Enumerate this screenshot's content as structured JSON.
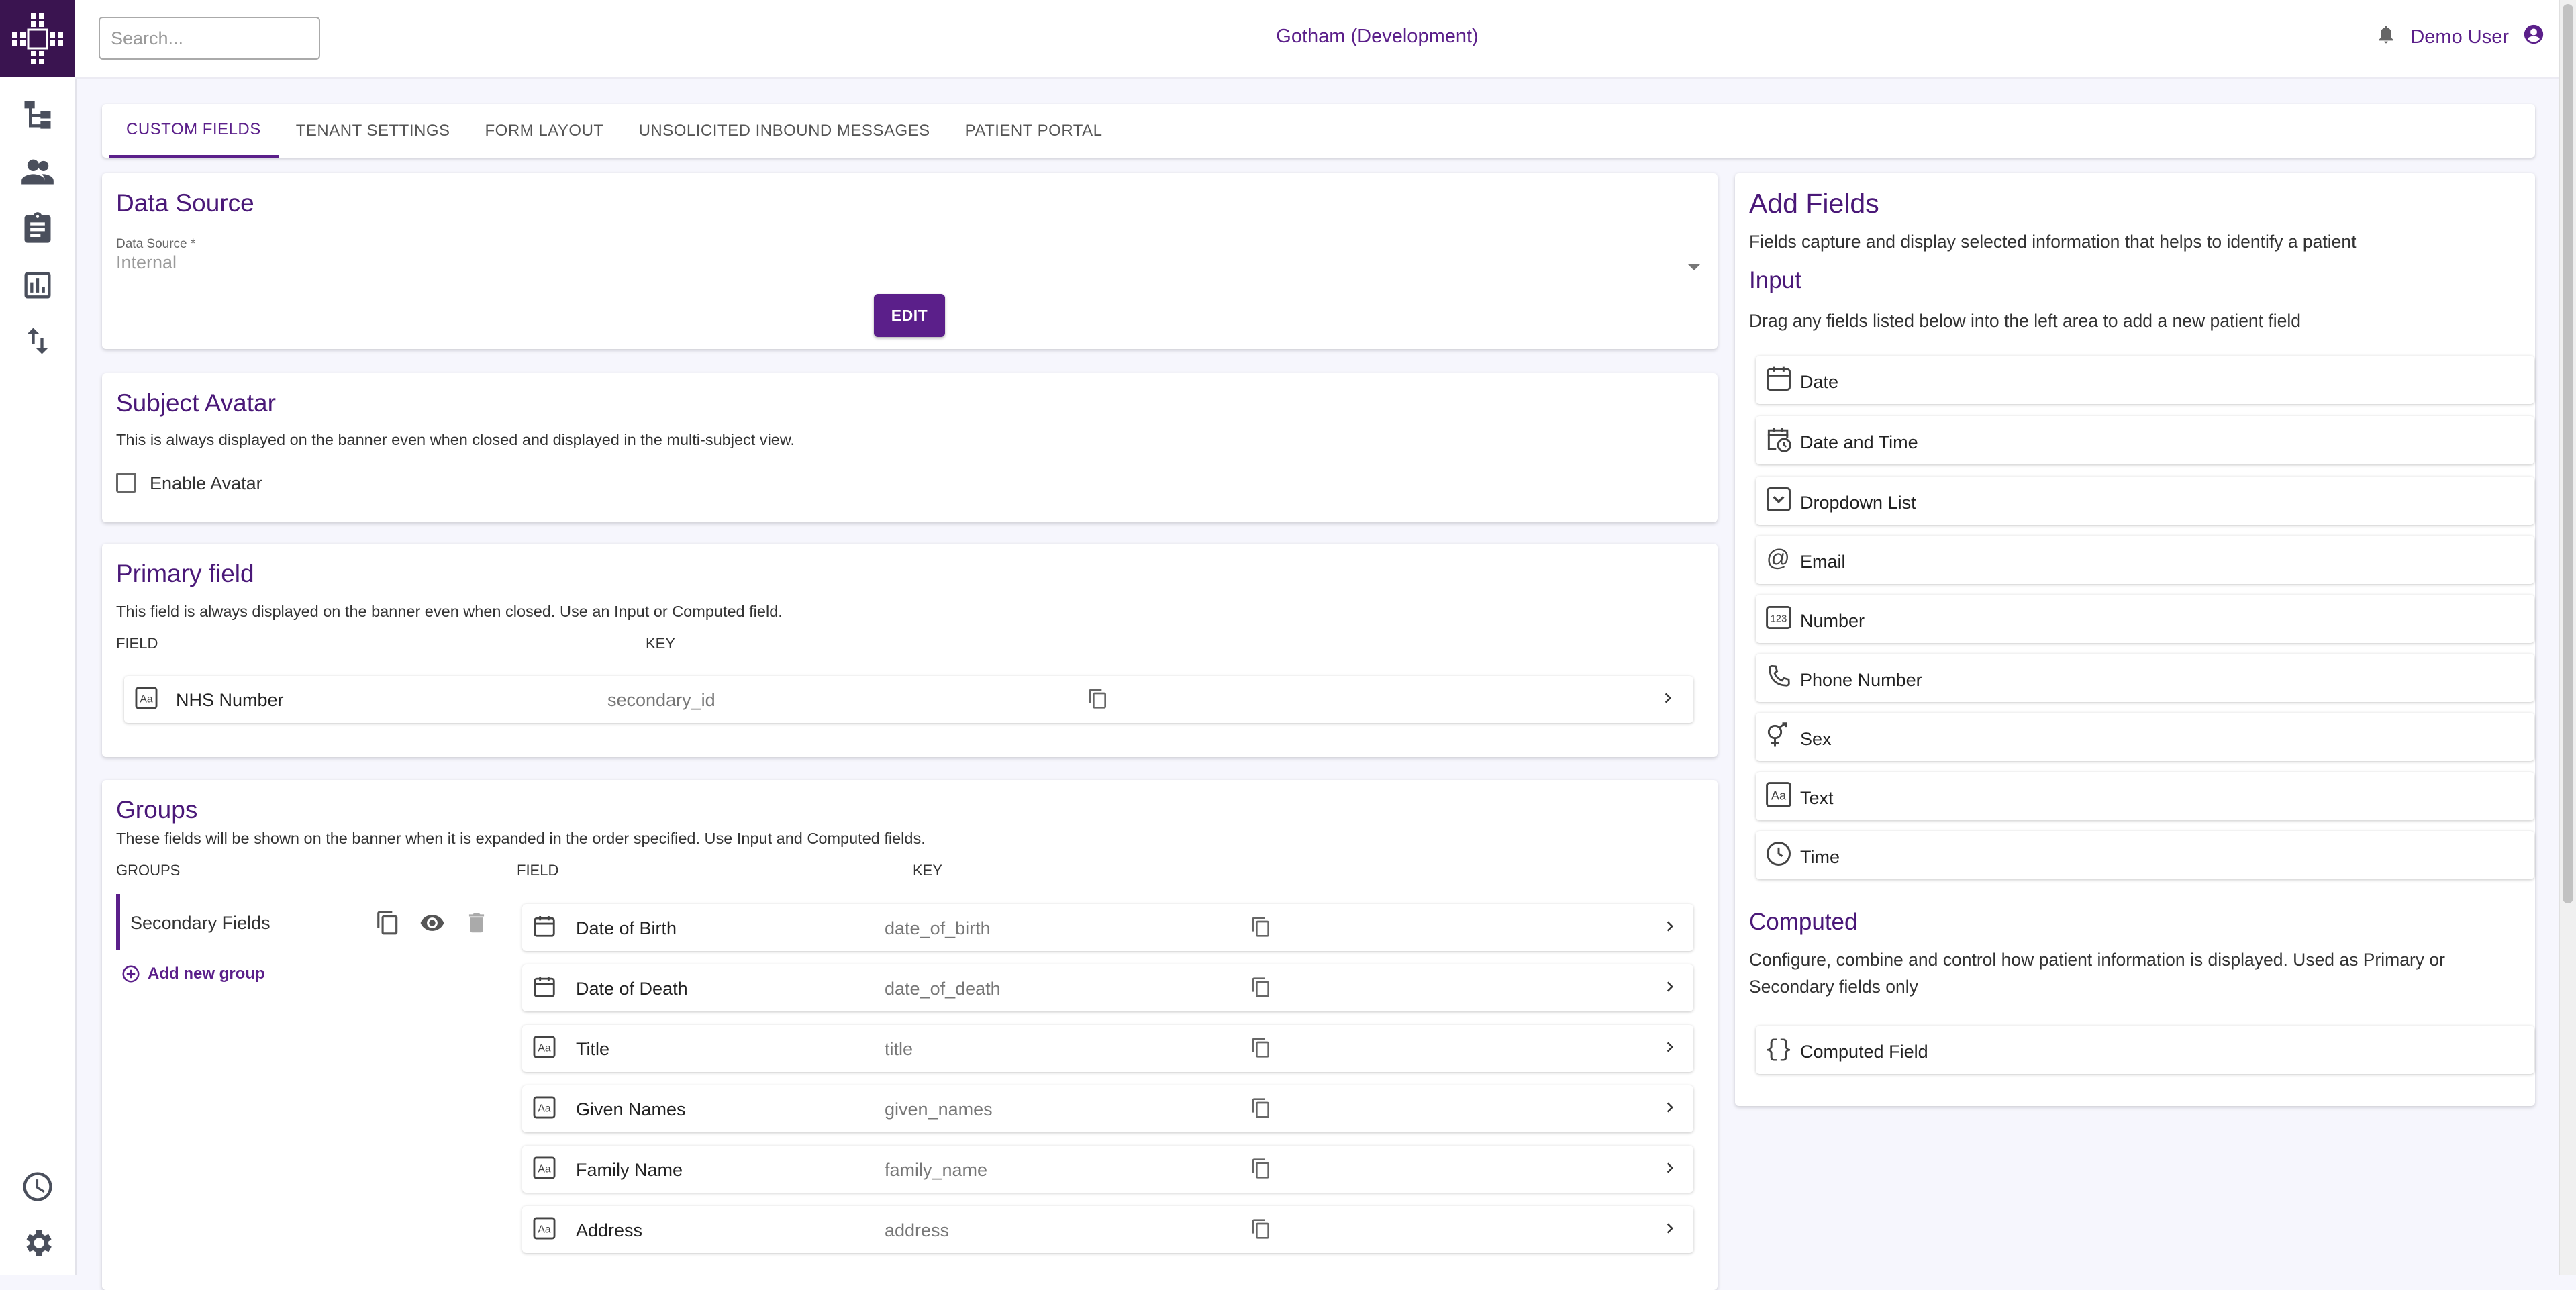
{
  "header": {
    "search_placeholder": "Search...",
    "environment": "Gotham (Development)",
    "user_name": "Demo User"
  },
  "tabs": [
    {
      "label": "Custom Fields"
    },
    {
      "label": "Tenant Settings"
    },
    {
      "label": "Form Layout"
    },
    {
      "label": "Unsolicited Inbound Messages"
    },
    {
      "label": "Patient Portal"
    }
  ],
  "data_source": {
    "title": "Data Source",
    "label": "Data Source *",
    "value": "Internal",
    "edit_label": "EDIT"
  },
  "subject_avatar": {
    "title": "Subject Avatar",
    "description": "This is always displayed on the banner even when closed and displayed in the multi-subject view.",
    "checkbox_label": "Enable Avatar"
  },
  "primary_field": {
    "title": "Primary field",
    "description": "This field is always displayed on the banner even when closed. Use an Input or Computed field.",
    "col_field": "FIELD",
    "col_key": "KEY",
    "row": {
      "name": "NHS Number",
      "key": "secondary_id",
      "icon": "text-aa-icon"
    }
  },
  "groups": {
    "title": "Groups",
    "description": "These fields will be shown on the banner when it is expanded in the order specified. Use Input and Computed fields.",
    "col_groups": "GROUPS",
    "col_field": "FIELD",
    "col_key": "KEY",
    "group_name": "Secondary Fields",
    "add_group_label": "Add new group",
    "fields": [
      {
        "name": "Date of Birth",
        "key": "date_of_birth",
        "icon": "calendar-icon"
      },
      {
        "name": "Date of Death",
        "key": "date_of_death",
        "icon": "calendar-icon"
      },
      {
        "name": "Title",
        "key": "title",
        "icon": "text-aa-icon"
      },
      {
        "name": "Given Names",
        "key": "given_names",
        "icon": "text-aa-icon"
      },
      {
        "name": "Family Name",
        "key": "family_name",
        "icon": "text-aa-icon"
      },
      {
        "name": "Address",
        "key": "address",
        "icon": "text-aa-icon"
      }
    ]
  },
  "add_fields": {
    "title": "Add Fields",
    "description": "Fields capture and display selected information that helps to identify a patient",
    "input_title": "Input",
    "input_description": "Drag any fields listed below into the left area to add a new patient field",
    "inputs": [
      {
        "label": "Date",
        "icon": "calendar-icon"
      },
      {
        "label": "Date and Time",
        "icon": "calendar-clock-icon"
      },
      {
        "label": "Dropdown List",
        "icon": "dropdown-icon"
      },
      {
        "label": "Email",
        "icon": "at-icon"
      },
      {
        "label": "Number",
        "icon": "number-123-icon"
      },
      {
        "label": "Phone Number",
        "icon": "phone-icon"
      },
      {
        "label": "Sex",
        "icon": "gender-icon"
      },
      {
        "label": "Text",
        "icon": "text-aa-icon"
      },
      {
        "label": "Time",
        "icon": "clock-icon"
      }
    ],
    "computed_title": "Computed",
    "computed_description": "Configure, combine and control how patient information is displayed. Used as Primary or Secondary fields only",
    "computed_item": {
      "label": "Computed Field",
      "icon": "braces-icon"
    }
  },
  "colors": {
    "brand": "#5b1f8a",
    "logo_bg": "#3a1450",
    "background": "#f6f6fd"
  }
}
